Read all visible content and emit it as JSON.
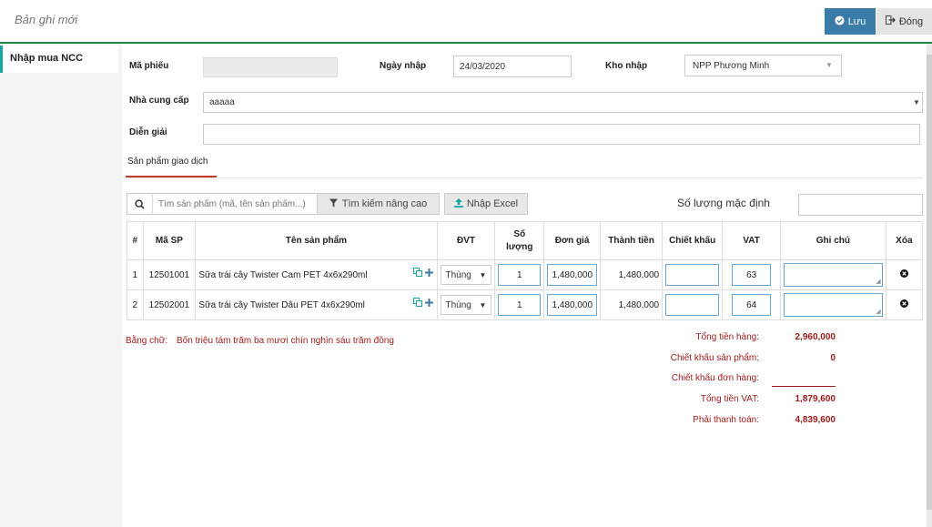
{
  "header": {
    "title": "Bản ghi mới",
    "save_label": "Lưu",
    "close_label": "Đóng"
  },
  "sidebar": {
    "items": [
      {
        "label": "Nhập mua NCC",
        "active": true
      }
    ]
  },
  "form": {
    "receipt_code_label": "Mã phiếu",
    "receipt_code_value": "",
    "date_label": "Ngày nhập",
    "date_value": "24/03/2020",
    "warehouse_label": "Kho nhập",
    "warehouse_value": "NPP Phương Minh",
    "supplier_label": "Nhà cung cấp",
    "supplier_value": "aaaaa",
    "description_label": "Diễn giải",
    "description_value": ""
  },
  "tabs": {
    "products_label": "Sản phẩm giao dịch"
  },
  "toolbar": {
    "search_placeholder": "Tìm sản phẩm (mã, tên sản phẩm...)",
    "advanced_search_label": "Tìm kiếm nâng cao",
    "import_excel_label": "Nhập Excel",
    "default_qty_label": "Số lượng mặc định",
    "default_qty_value": ""
  },
  "table": {
    "headers": {
      "index": "#",
      "code": "Mã SP",
      "name": "Tên sản phẩm",
      "unit": "ĐVT",
      "qty_line1": "Số",
      "qty_line2": "lượng",
      "price": "Đơn giá",
      "amount": "Thành tiền",
      "discount": "Chiết khấu",
      "vat": "VAT",
      "note": "Ghi chú",
      "delete": "Xóa"
    },
    "rows": [
      {
        "index": "1",
        "code": "12501001",
        "name": "Sữa trái cây Twister Cam PET 4x6x290ml",
        "unit": "Thùng",
        "qty": "1",
        "price": "1,480,000",
        "amount": "1,480,000",
        "discount": "",
        "vat": "63",
        "note": ""
      },
      {
        "index": "2",
        "code": "12502001",
        "name": "Sữa trái cây Twister Dâu PET 4x6x290ml",
        "unit": "Thùng",
        "qty": "1",
        "price": "1,480,000",
        "amount": "1,480,000",
        "discount": "",
        "vat": "64",
        "note": ""
      }
    ]
  },
  "summary": {
    "words_label": "Bằng chữ:",
    "words_value": "Bốn triệu tám trăm ba mươi chín nghìn sáu trăm đồng",
    "total_goods_label": "Tổng tiền hàng:",
    "total_goods_value": "2,960,000",
    "product_discount_label": "Chiết khấu sản phẩm:",
    "product_discount_value": "0",
    "order_discount_label": "Chiết khấu đơn hàng:",
    "order_discount_value": "",
    "total_vat_label": "Tổng tiền VAT:",
    "total_vat_value": "1,879,600",
    "payable_label": "Phải thanh toán:",
    "payable_value": "4,839,600"
  },
  "colors": {
    "primary": "#3b7ba8",
    "accent_green": "#1e8a3e",
    "accent_teal": "#1aa6a0",
    "tab_red": "#c0392b",
    "summary_red": "#a01c1c",
    "input_focus": "#6aa6d8"
  },
  "icons": [
    "save-icon",
    "close-icon",
    "search-icon",
    "filter-icon",
    "upload-icon",
    "copy-icon",
    "plus-icon",
    "delete-icon",
    "chevron-down-icon"
  ]
}
